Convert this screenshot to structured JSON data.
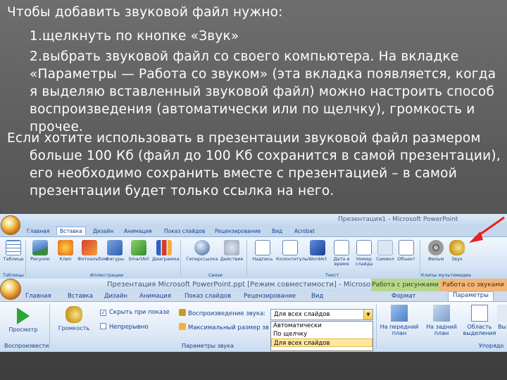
{
  "slide": {
    "intro": "Чтобы добавить звуковой файл нужно:",
    "step1": "1.щелкнуть по кнопке «Звук»",
    "step2": "2.выбрать звуковой файл со своего компьютера. На вкладке «Параметры — Работа со звуком» (эта вкладка появляется, когда я выделяю вставленный звуковой файл) можно настроить способ воспроизведения (автоматически или по щелчку), громкость и прочее.",
    "note": "Если хотите использовать в презентации звуковой файл размером больше 100 Кб (файл до 100 Кб сохранится в самой презентации), его необходимо сохранить вместе с презентацией – в самой презентации будет только ссылка на него."
  },
  "shot1": {
    "window_title": "Презентация1 - Microsoft PowerPoint",
    "tabs": [
      "Главная",
      "Вставка",
      "Дизайн",
      "Анимация",
      "Показ слайдов",
      "Рецензирование",
      "Вид",
      "Acrobat"
    ],
    "active_tab": "Вставка",
    "buttons": {
      "table": "Таблица",
      "picture": "Рисунок",
      "clip": "Клип",
      "album": "Фотоальбом",
      "shapes": "Фигуры",
      "smartart": "SmartArt",
      "chart": "Диаграмма",
      "hyperlink": "Гиперссылка",
      "action": "Действие",
      "textbox": "Надпись",
      "header": "Колонтитулы",
      "wordart": "WordArt",
      "datetime": "Дата и время",
      "slidenum": "Номер слайда",
      "symbol": "Символ",
      "object": "Объект",
      "movie": "Фильм",
      "sound": "Звук"
    },
    "groups": {
      "tables": "Таблицы",
      "illustrations": "Иллюстрации",
      "links": "Связи",
      "text": "Текст",
      "media": "Клипы мультимедиа"
    },
    "colors": {
      "arrow": "#e8201c",
      "accent": "#15428b"
    }
  },
  "shot2": {
    "window_title": "Презентация Microsoft PowerPoint.ppt [Режим совместимости] - Microsoft P...",
    "context_picture": "Работа с рисунками",
    "context_sound": "Работа со звуками",
    "tabs": [
      "Главная",
      "Вставка",
      "Дизайн",
      "Анимация",
      "Показ слайдов",
      "Рецензирование",
      "Вид",
      "Формат",
      "Параметры"
    ],
    "active_tab": "Параметры",
    "preview": "Просмотр",
    "volume": "Громкость",
    "hide_on_show": "Скрыть при показе",
    "loop": "Непрерывно",
    "play_sound": "Воспроизведение звука:",
    "max_size": "Максимальный размер зв",
    "play_value": "Для всех слайдов",
    "options": [
      "Автоматически",
      "По щелчку",
      "Для всех слайдов"
    ],
    "bring_forward": "На передний план",
    "send_back": "На задний план",
    "selection_pane": "Область выделения",
    "cut_label": "Вы",
    "groups": {
      "play": "Воспроизвести",
      "sound_options": "Параметры звука",
      "arrange": "Упорядо"
    }
  }
}
